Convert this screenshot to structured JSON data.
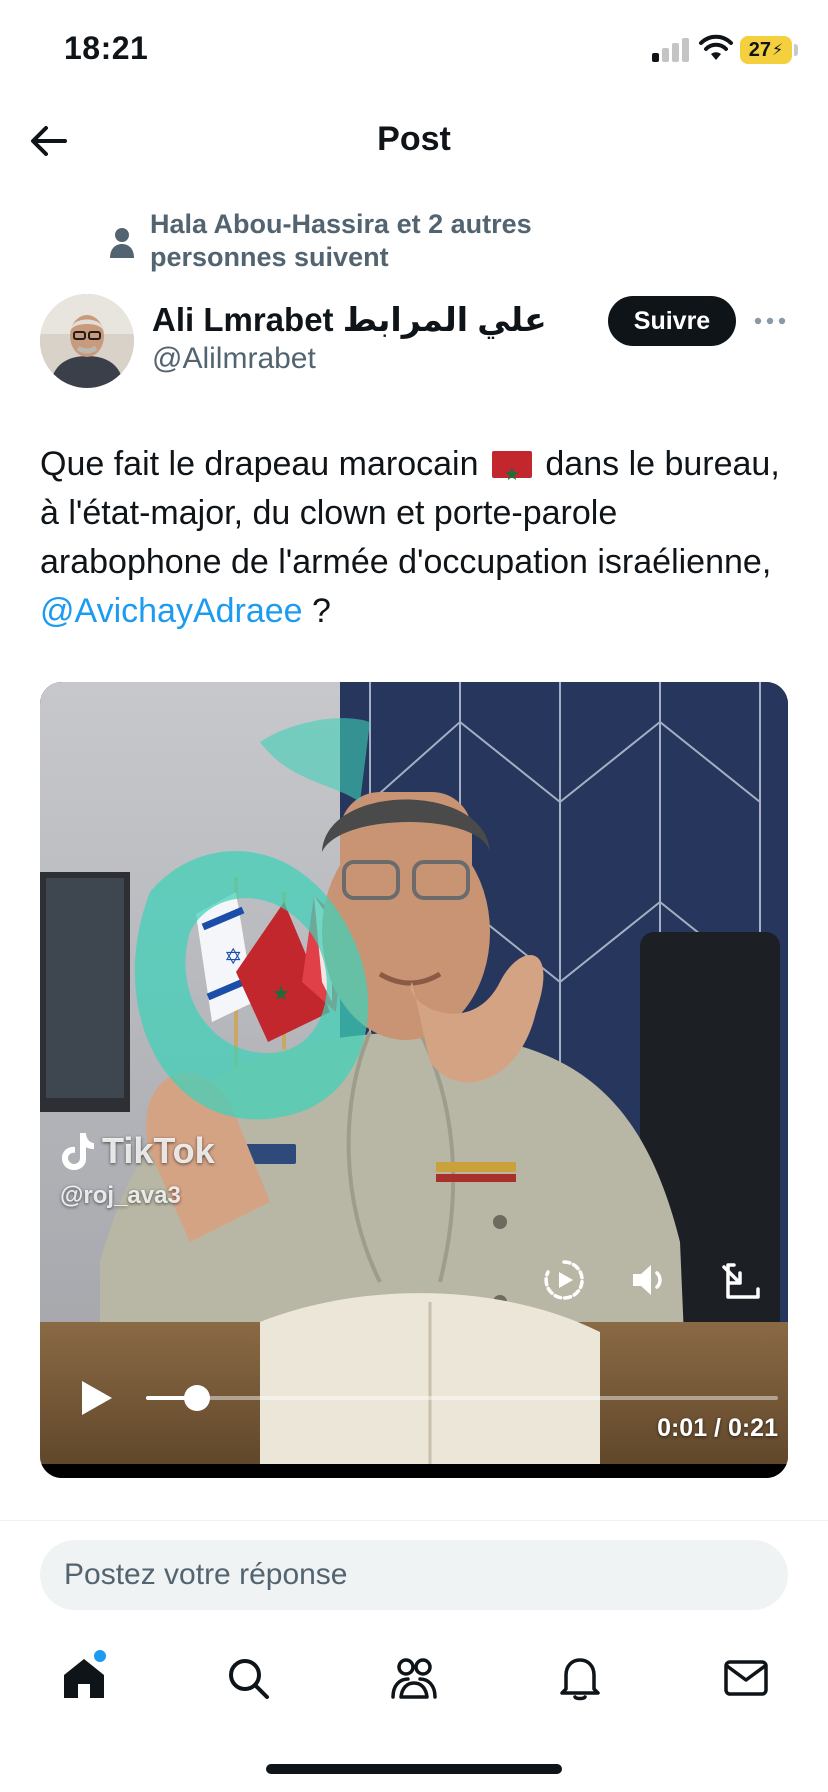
{
  "status_bar": {
    "time": "18:21",
    "battery": "27",
    "signal_bars_active": 1,
    "icons": [
      "signal-icon",
      "wifi-icon",
      "battery-icon"
    ]
  },
  "header": {
    "title": "Post",
    "back_icon": "arrow-left-icon"
  },
  "social_context": {
    "text": "Hala Abou-Hassira et 2 autres personnes suivent",
    "icon": "person-icon"
  },
  "author": {
    "name": "Ali Lmrabet علي المرابط",
    "handle": "@Alilmrabet",
    "follow_label": "Suivre"
  },
  "tweet": {
    "text_before_flag": "Que fait le drapeau marocain",
    "text_after_flag": "dans le bureau, à l'état-major, du clown et porte-parole arabophone de l'armée d'occupation israélienne,",
    "mention": "@AvichayAdraee",
    "text_end": "?"
  },
  "video": {
    "watermark_brand": "TikTok",
    "watermark_user": "@roj_ava3",
    "current_time": "0:01",
    "duration": "0:21",
    "time_label": "0:01 / 0:21",
    "progress": 0.08,
    "controls": [
      "play-icon",
      "replay-speed-icon",
      "volume-icon",
      "fullscreen-icon"
    ]
  },
  "reply": {
    "placeholder": "Postez votre réponse"
  },
  "tabbar": {
    "items": [
      "home-icon",
      "search-icon",
      "communities-icon",
      "notifications-icon",
      "messages-icon"
    ],
    "home_has_badge": true
  },
  "colors": {
    "accent": "#1d9bf0",
    "text": "#0f1419",
    "secondary": "#536471",
    "battery": "#f4d03f"
  }
}
